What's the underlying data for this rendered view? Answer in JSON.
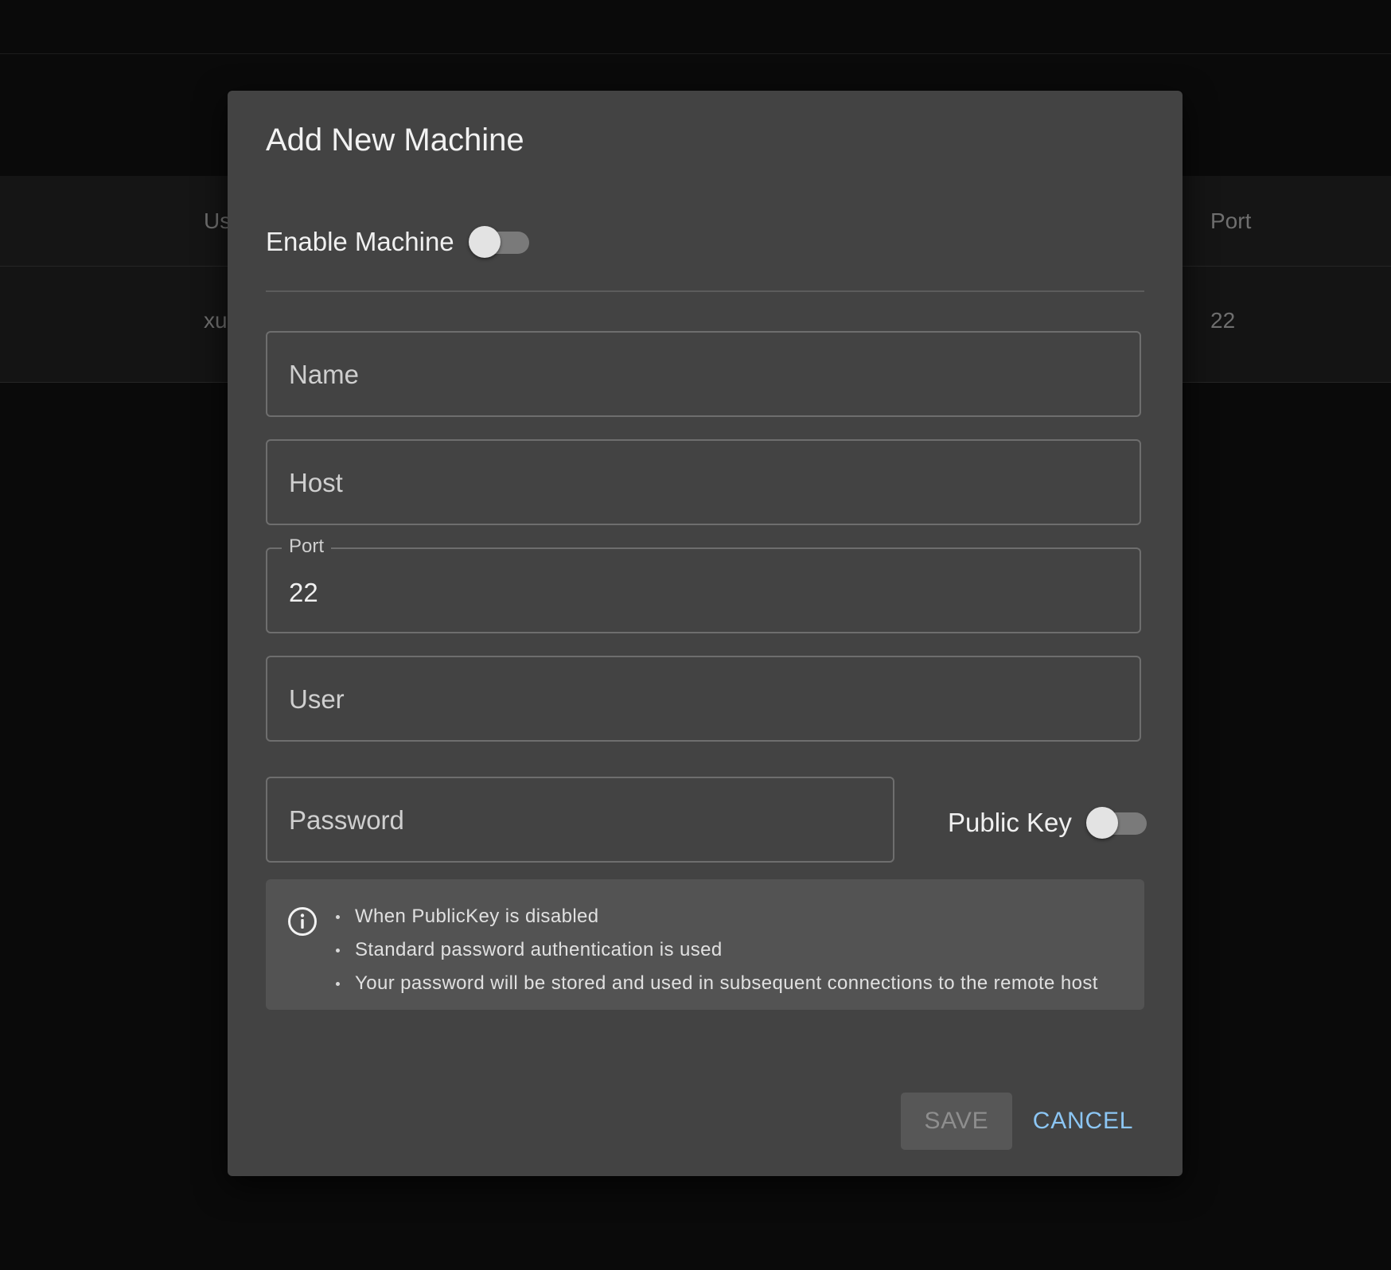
{
  "background": {
    "table": {
      "headers": [
        "Us",
        "Port"
      ],
      "row": [
        "xu",
        "22"
      ]
    }
  },
  "dialog": {
    "title": "Add New Machine",
    "enable_machine": {
      "label": "Enable Machine",
      "checked": false
    },
    "fields": {
      "name": {
        "placeholder": "Name",
        "value": ""
      },
      "host": {
        "placeholder": "Host",
        "value": ""
      },
      "port": {
        "label": "Port",
        "value": "22"
      },
      "user": {
        "placeholder": "User",
        "value": ""
      },
      "password": {
        "placeholder": "Password",
        "value": ""
      }
    },
    "public_key": {
      "label": "Public Key",
      "checked": false
    },
    "info": {
      "icon": "info-circle-icon",
      "items": [
        "When PublicKey is disabled",
        "Standard password authentication is used",
        "Your password will be stored and used in subsequent connections to the remote host"
      ]
    },
    "actions": {
      "save_label": "SAVE",
      "cancel_label": "CANCEL"
    }
  },
  "colors": {
    "accent": "#8cc6f4",
    "dialog_bg": "#434343",
    "info_bg": "#535353",
    "page_bg": "#0a0a0a"
  }
}
